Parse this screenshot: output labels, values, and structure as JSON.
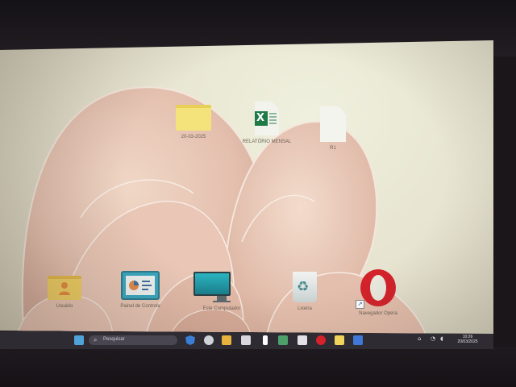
{
  "desktop": {
    "icons": [
      {
        "id": "folder-1",
        "label": "20-03-2025",
        "kind": "folder"
      },
      {
        "id": "excel-1",
        "label": "RELATÓRIO MENSAL",
        "kind": "excel"
      },
      {
        "id": "file-1",
        "label": "R1",
        "kind": "file"
      },
      {
        "id": "user-folder",
        "label": "Usuário",
        "kind": "user-folder"
      },
      {
        "id": "whiteboard",
        "label": "Painel de Controle",
        "kind": "control-panel"
      },
      {
        "id": "this-pc",
        "label": "Este Computador",
        "kind": "monitor"
      },
      {
        "id": "recycle-bin",
        "label": "Lixeira",
        "kind": "recycle-bin"
      },
      {
        "id": "opera",
        "label": "Navegador Opera",
        "kind": "opera-shortcut"
      }
    ]
  },
  "taskbar": {
    "search_placeholder": "Pesquisar",
    "clock_time": "10:26",
    "clock_date": "20/03/2025",
    "icons": [
      "widgets-icon",
      "shield-icon",
      "settings-icon",
      "chat-icon",
      "file-explorer-icon",
      "app-icon",
      "store-icon",
      "phone-icon",
      "opera-icon",
      "folder-icon",
      "mail-icon"
    ]
  },
  "colors": {
    "taskbar_bg": "#2e2b33",
    "wallpaper_light": "#eff0de",
    "wallpaper_bloom": "#e7c8b8",
    "opera_red": "#d3222a",
    "excel_green": "#1f7a45",
    "folder_yellow": "#f3e37a"
  }
}
